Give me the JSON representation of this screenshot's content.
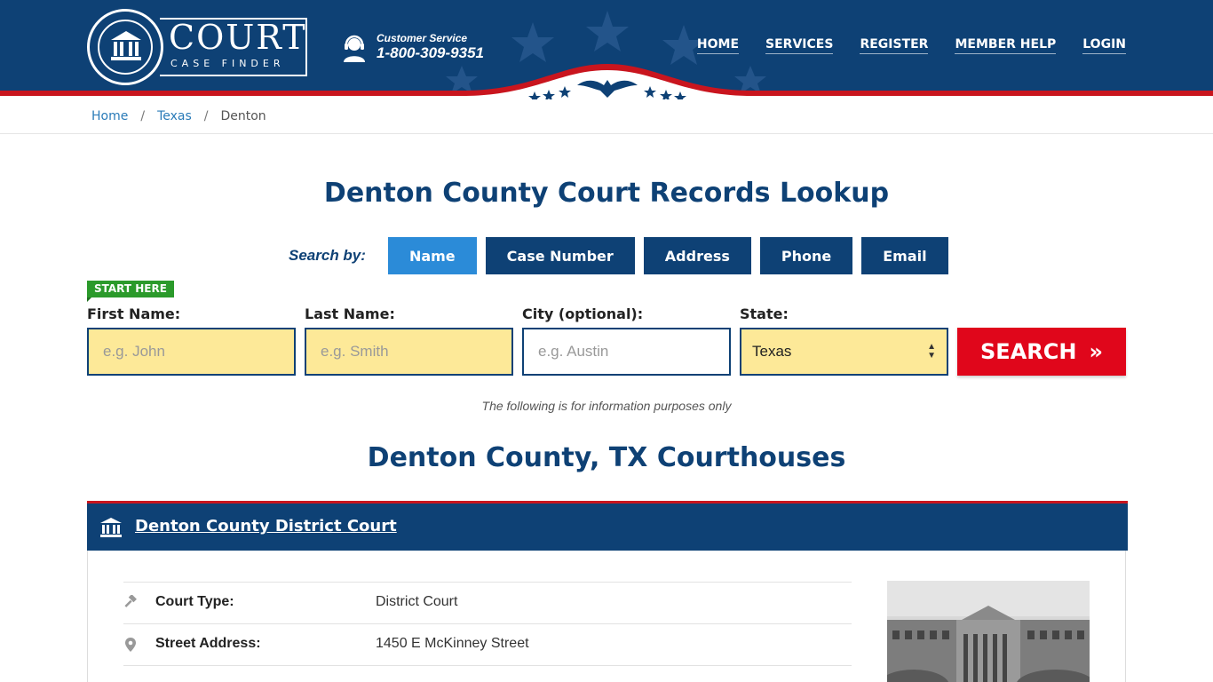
{
  "brand": {
    "logo_main": "COURT",
    "logo_sub": "CASE FINDER",
    "cs_label": "Customer Service",
    "cs_phone": "1-800-309-9351",
    "primary_color": "#0e4175",
    "accent_color": "#e0061b"
  },
  "nav": {
    "items": [
      {
        "label": "HOME"
      },
      {
        "label": "SERVICES"
      },
      {
        "label": "REGISTER"
      },
      {
        "label": "MEMBER HELP"
      },
      {
        "label": "LOGIN"
      }
    ]
  },
  "breadcrumb": {
    "items": [
      "Home",
      "Texas",
      "Denton"
    ]
  },
  "page": {
    "title": "Denton County Court Records Lookup",
    "search_by_label": "Search by:",
    "tabs": [
      {
        "label": "Name",
        "active": true
      },
      {
        "label": "Case Number",
        "active": false
      },
      {
        "label": "Address",
        "active": false
      },
      {
        "label": "Phone",
        "active": false
      },
      {
        "label": "Email",
        "active": false
      }
    ],
    "start_here": "START HERE",
    "fields": {
      "first_name_label": "First Name:",
      "first_name_placeholder": "e.g. John",
      "last_name_label": "Last Name:",
      "last_name_placeholder": "e.g. Smith",
      "city_label": "City (optional):",
      "city_placeholder": "e.g.  Austin",
      "state_label": "State:",
      "state_value": "Texas"
    },
    "search_button": "SEARCH",
    "note": "The following is for information purposes only",
    "courthouses_title": "Denton County, TX Courthouses"
  },
  "court": {
    "name": "Denton County District Court",
    "rows": [
      {
        "key": "Court Type:",
        "value": "District Court",
        "icon": "gavel-icon"
      },
      {
        "key": "Street Address:",
        "value": "1450 E McKinney Street",
        "icon": "map-pin-icon"
      }
    ]
  }
}
